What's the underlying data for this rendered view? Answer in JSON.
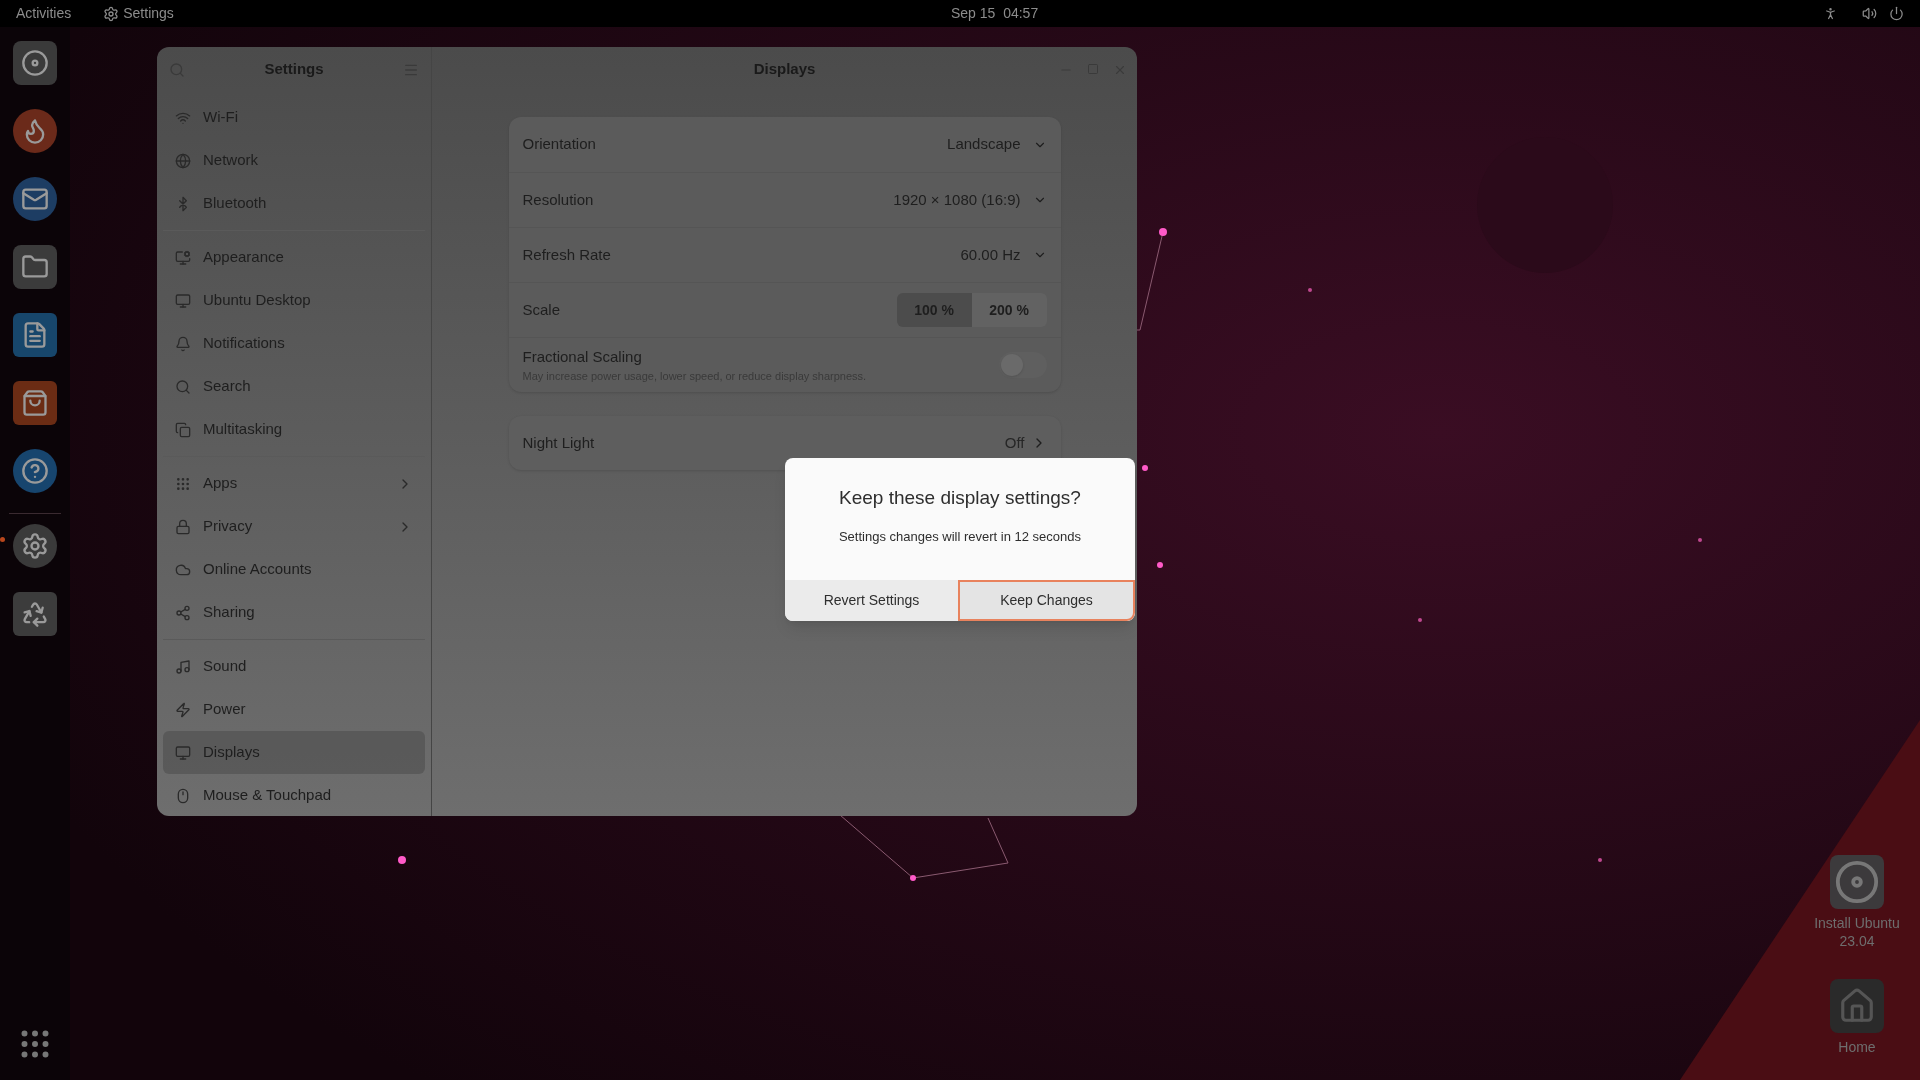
{
  "top_bar": {
    "activities": "Activities",
    "app_name": "Settings",
    "clock": "Sep 15  04:57"
  },
  "dock": {
    "apps": [
      {
        "running": false
      },
      {
        "running": false
      },
      {
        "running": false
      },
      {
        "running": false
      },
      {
        "running": false
      },
      {
        "running": false
      },
      {
        "running": false
      },
      {
        "running": true
      },
      {
        "running": false
      }
    ]
  },
  "settings_window": {
    "sidebar": {
      "title": "Settings",
      "groups": [
        [
          {
            "label": "Wi-Fi",
            "selected": false,
            "expandable": false
          },
          {
            "label": "Network",
            "selected": false,
            "expandable": false
          },
          {
            "label": "Bluetooth",
            "selected": false,
            "expandable": false
          }
        ],
        [
          {
            "label": "Appearance",
            "selected": false,
            "expandable": false
          },
          {
            "label": "Ubuntu Desktop",
            "selected": false,
            "expandable": false
          },
          {
            "label": "Notifications",
            "selected": false,
            "expandable": false
          },
          {
            "label": "Search",
            "selected": false,
            "expandable": false
          },
          {
            "label": "Multitasking",
            "selected": false,
            "expandable": false
          }
        ],
        [
          {
            "label": "Apps",
            "selected": false,
            "expandable": true
          },
          {
            "label": "Privacy",
            "selected": false,
            "expandable": true
          },
          {
            "label": "Online Accounts",
            "selected": false,
            "expandable": false
          },
          {
            "label": "Sharing",
            "selected": false,
            "expandable": false
          }
        ],
        [
          {
            "label": "Sound",
            "selected": false,
            "expandable": false
          },
          {
            "label": "Power",
            "selected": false,
            "expandable": false
          },
          {
            "label": "Displays",
            "selected": true,
            "expandable": false
          },
          {
            "label": "Mouse & Touchpad",
            "selected": false,
            "expandable": false
          }
        ]
      ]
    },
    "title": "Displays",
    "rows": [
      {
        "kind": "dropdown",
        "label": "Orientation",
        "value": "Landscape"
      },
      {
        "kind": "dropdown",
        "label": "Resolution",
        "value": "1920 × 1080 (16:9)"
      },
      {
        "kind": "dropdown",
        "label": "Refresh Rate",
        "value": "60.00 Hz"
      },
      {
        "kind": "segmented",
        "label": "Scale",
        "options": [
          {
            "label": "100 %",
            "selected": true
          },
          {
            "label": "200 %",
            "selected": false
          }
        ]
      },
      {
        "kind": "switch",
        "label": "Fractional Scaling",
        "description": "May increase power usage, lower speed, or reduce display sharpness.",
        "on": false
      }
    ],
    "night_light": {
      "label": "Night Light",
      "value": "Off"
    }
  },
  "dialog": {
    "title": "Keep these display settings?",
    "message": "Settings changes will revert in 12 seconds",
    "buttons": [
      {
        "label": "Revert Settings",
        "focused": false
      },
      {
        "label": "Keep Changes",
        "focused": true
      }
    ]
  },
  "desktop_icons": [
    {
      "label": "Install Ubuntu 23.04"
    },
    {
      "label": "Home"
    }
  ]
}
